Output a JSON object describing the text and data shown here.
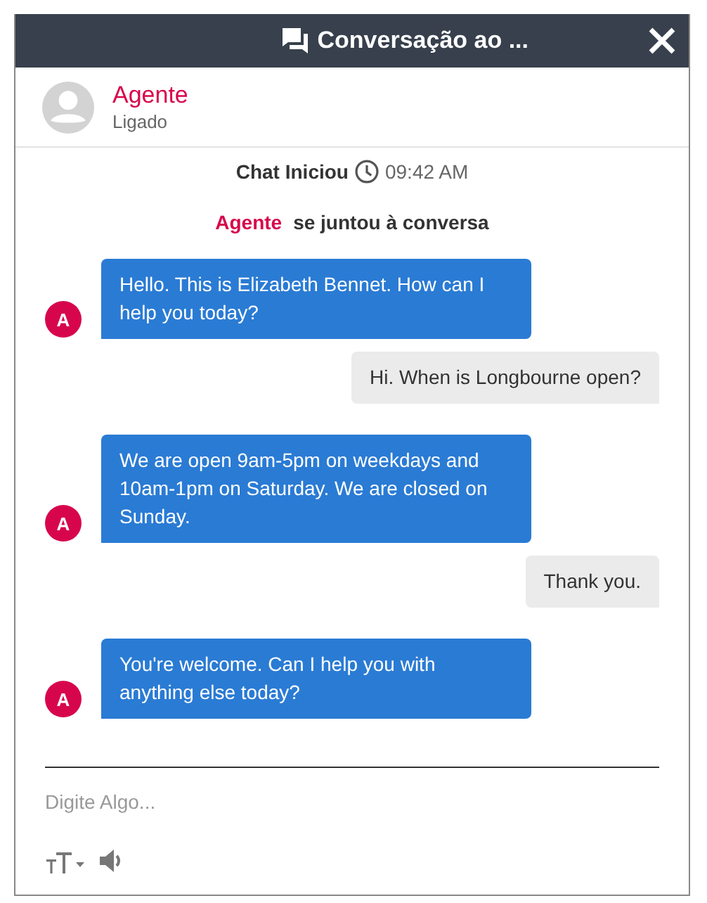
{
  "window": {
    "title": "Conversação ao ..."
  },
  "agent": {
    "name": "Agente",
    "status": "Ligado"
  },
  "chat_started": {
    "label": "Chat Iniciou",
    "time": "09:42 AM"
  },
  "joined": {
    "name": "Agente",
    "text": "se juntou à conversa"
  },
  "messages": [
    {
      "kind": "agent",
      "avatar": "A",
      "text": "Hello. This is Elizabeth Bennet. How can I help you today?"
    },
    {
      "kind": "user",
      "text": "Hi. When is Longbourne open?"
    },
    {
      "kind": "agent",
      "avatar": "A",
      "text": "We are open 9am-5pm on weekdays and 10am-1pm on Saturday. We are closed on Sunday."
    },
    {
      "kind": "user",
      "text": "Thank you."
    },
    {
      "kind": "agent",
      "avatar": "A",
      "text": "You're welcome. Can I help you with anything else today?"
    }
  ],
  "input": {
    "placeholder": "Digite Algo..."
  }
}
